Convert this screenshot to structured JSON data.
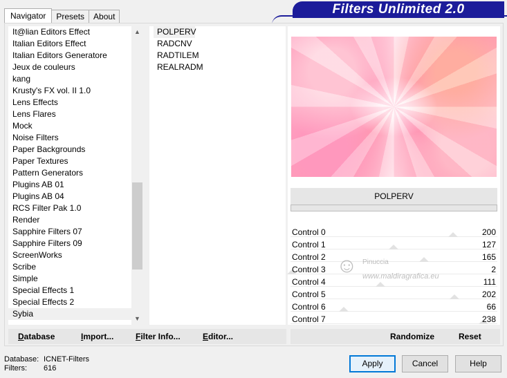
{
  "title": "Filters Unlimited 2.0",
  "tabs": [
    {
      "label": "Navigator",
      "active": true
    },
    {
      "label": "Presets",
      "active": false
    },
    {
      "label": "About",
      "active": false
    }
  ],
  "categories": [
    "It@lian Editors Effect",
    "Italian Editors Effect",
    "Italian Editors Generatore",
    "Jeux de couleurs",
    "kang",
    "Krusty's FX vol. II 1.0",
    "Lens Effects",
    "Lens Flares",
    "Mock",
    "Noise Filters",
    "Paper Backgrounds",
    "Paper Textures",
    "Pattern Generators",
    "Plugins AB 01",
    "Plugins AB 04",
    "RCS Filter Pak 1.0",
    "Render",
    "Sapphire Filters 07",
    "Sapphire Filters 09",
    "ScreenWorks",
    "Scribe",
    "Simple",
    "Special Effects 1",
    "Special Effects 2",
    "Sybia"
  ],
  "selected_category": "Sybia",
  "filters": [
    "POLPERV",
    "RADCNV",
    "RADTILEM",
    "REALRADM"
  ],
  "selected_filter": "POLPERV",
  "effect_name": "POLPERV",
  "controls": [
    {
      "label": "Control 0",
      "value": "200",
      "level": 200
    },
    {
      "label": "Control 1",
      "value": "127",
      "level": 127
    },
    {
      "label": "Control 2",
      "value": "165",
      "level": 165
    },
    {
      "label": "Control 3",
      "value": "2",
      "level": 2
    },
    {
      "label": "Control 4",
      "value": "111",
      "level": 111
    },
    {
      "label": "Control 5",
      "value": "202",
      "level": 202
    },
    {
      "label": "Control 6",
      "value": "66",
      "level": 66
    },
    {
      "label": "Control 7",
      "value": "238",
      "level": 238
    }
  ],
  "control_max": 255,
  "watermark": {
    "name": "Pinuccia",
    "url": "www.maldiragrafica.eu"
  },
  "toolbar": {
    "database": "Database",
    "import": "Import...",
    "filter_info": "Filter Info...",
    "editor": "Editor...",
    "randomize": "Randomize",
    "reset": "Reset"
  },
  "status": {
    "database_label": "Database:",
    "database_value": "ICNET-Filters",
    "filters_label": "Filters:",
    "filters_value": "616"
  },
  "dialog": {
    "apply": "Apply",
    "cancel": "Cancel",
    "help": "Help"
  },
  "colors": {
    "banner": "#1c1c9a",
    "accent": "#0078d7"
  }
}
